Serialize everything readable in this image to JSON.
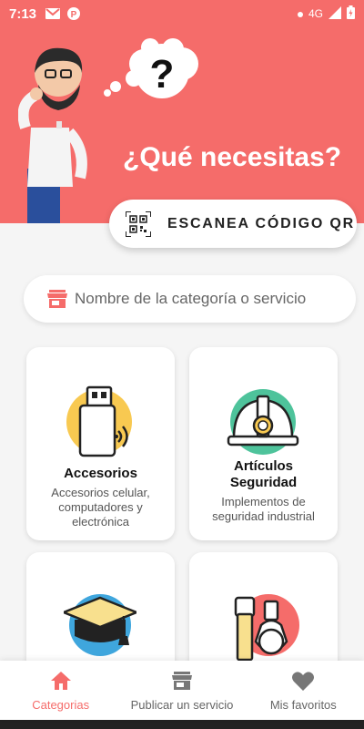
{
  "status_bar": {
    "time": "7:13",
    "network": "4G"
  },
  "hero": {
    "title": "¿Qué necesitas?"
  },
  "qr_button": {
    "label": "ESCANEA CÓDIGO QR"
  },
  "search": {
    "placeholder": "Nombre de la categoría o servicio"
  },
  "categories": [
    {
      "title": "Accesorios",
      "description": "Accesorios celular, computadores y electrónica",
      "icon": "usb-drive-icon"
    },
    {
      "title": "Artículos Seguridad",
      "description": "Implementos de seguridad industrial",
      "icon": "safety-helmet-icon"
    },
    {
      "title": "",
      "description": "",
      "icon": "graduation-cap-icon"
    },
    {
      "title": "",
      "description": "",
      "icon": "cosmetics-icon"
    }
  ],
  "bottom_nav": {
    "items": [
      {
        "label": "Categorias",
        "icon": "home-icon",
        "active": true
      },
      {
        "label": "Publicar un servicio",
        "icon": "store-icon",
        "active": false
      },
      {
        "label": "Mis favoritos",
        "icon": "heart-icon",
        "active": false
      }
    ]
  },
  "colors": {
    "accent": "#f56c6a",
    "background": "#f5f5f5",
    "card": "#ffffff"
  }
}
